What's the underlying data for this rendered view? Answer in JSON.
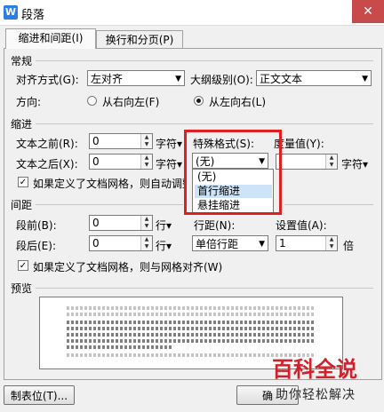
{
  "window": {
    "title": "段落",
    "app_icon_letter": "W",
    "close_glyph": "✕"
  },
  "tabs": [
    {
      "label": "缩进和间距(I)"
    },
    {
      "label": "换行和分页(P)"
    }
  ],
  "general": {
    "section_label": "常规",
    "alignment_label": "对齐方式(G):",
    "alignment_value": "左对齐",
    "outline_label": "大纲级别(O):",
    "outline_value": "正文文本",
    "direction_label": "方向:",
    "rtl_label": "从右向左(F)",
    "ltr_label": "从左向右(L)"
  },
  "indent": {
    "section_label": "缩进",
    "before_label": "文本之前(R):",
    "before_value": "0",
    "before_unit": "字符▾",
    "after_label": "文本之后(X):",
    "after_value": "0",
    "after_unit": "字符▾",
    "special_label": "特殊格式(S):",
    "special_value": "(无)",
    "measure_label": "度量值(Y):",
    "measure_unit": "字符▾",
    "grid_check_label": "如果定义了文档网格，则自动调整",
    "dropdown_options": [
      "(无)",
      "首行缩进",
      "悬挂缩进"
    ]
  },
  "spacing": {
    "section_label": "间距",
    "before_label": "段前(B):",
    "before_value": "0",
    "before_unit": "行▾",
    "after_label": "段后(E):",
    "after_value": "0",
    "after_unit": "行▾",
    "line_label": "行距(N):",
    "line_value": "单倍行距",
    "setting_label": "设置值(A):",
    "setting_value": "1",
    "setting_unit": "倍",
    "grid_check_label": "如果定义了文档网格，则与网格对齐(W)"
  },
  "preview": {
    "section_label": "预览"
  },
  "footer": {
    "tabs_button": "制表位(T)...",
    "ok_button": "确"
  },
  "watermark": {
    "main": "百科全说",
    "sub": "助你轻松解决"
  },
  "colors": {
    "highlight": "#e02020",
    "close": "#c94a4a",
    "watermark": "#d0202a"
  }
}
